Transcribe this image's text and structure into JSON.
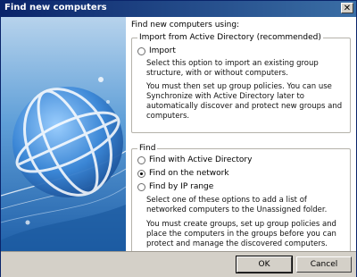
{
  "window": {
    "title": "Find new computers",
    "close_label": "✕"
  },
  "intro": "Find new computers using:",
  "import_group": {
    "legend": "Import from Active Directory (recommended)",
    "option": {
      "label": "Import",
      "selected": false
    },
    "desc1": "Select this option to import an existing group structure, with or without computers.",
    "desc2": "You must then set up group policies. You can use Synchronize with Active Directory later to automatically discover and protect new groups and computers."
  },
  "find_group": {
    "legend": "Find",
    "options": [
      {
        "label": "Find with Active Directory",
        "selected": false
      },
      {
        "label": "Find on the network",
        "selected": true
      },
      {
        "label": "Find by IP range",
        "selected": false
      }
    ],
    "desc1": "Select one of these options to add a list of networked computers to the Unassigned folder.",
    "desc2": "You must create groups, set up group policies and place the computers in the groups before you can protect and manage the discovered computers."
  },
  "buttons": {
    "ok": "OK",
    "cancel": "Cancel"
  },
  "colors": {
    "titlebar_start": "#0a246a",
    "titlebar_end": "#3a6ea5",
    "art_blue": "#2f7fd0"
  }
}
